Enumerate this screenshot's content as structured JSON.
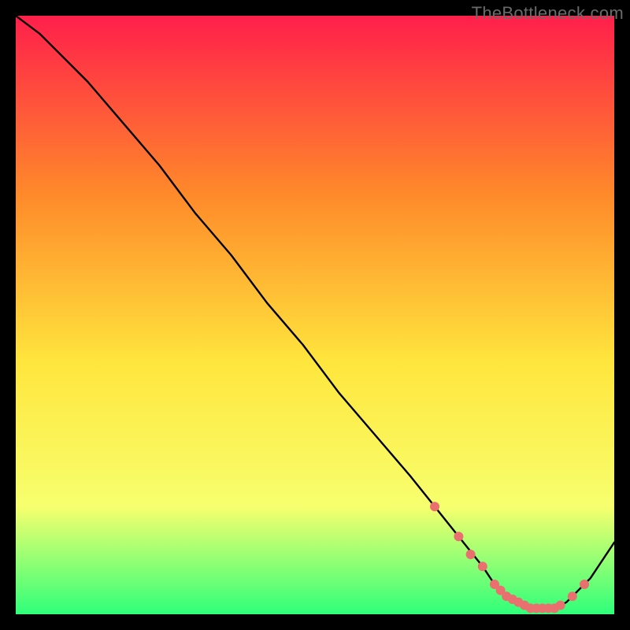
{
  "watermark": "TheBottleneck.com",
  "colors": {
    "background": "#000000",
    "gradient_top": "#ff1f4b",
    "gradient_mid1": "#ff8a2a",
    "gradient_mid2": "#ffe63d",
    "gradient_mid3": "#f7ff6e",
    "gradient_bottom": "#2fff7a",
    "curve": "#000000",
    "marker": "#e9706f"
  },
  "chart_data": {
    "type": "line",
    "title": "",
    "xlabel": "",
    "ylabel": "",
    "xlim": [
      0,
      100
    ],
    "ylim": [
      0,
      100
    ],
    "grid": false,
    "series": [
      {
        "name": "bottleneck-curve",
        "x": [
          0,
          4,
          8,
          12,
          18,
          24,
          30,
          36,
          42,
          48,
          54,
          60,
          66,
          70,
          74,
          78,
          80,
          82,
          84,
          86,
          88,
          90,
          92,
          96,
          100
        ],
        "y": [
          100,
          97,
          93,
          89,
          82,
          75,
          67,
          60,
          52,
          45,
          37,
          30,
          23,
          18,
          13,
          8,
          5,
          3,
          2,
          1,
          1,
          1,
          2,
          6,
          12
        ]
      }
    ],
    "markers": {
      "name": "optimal-range-points",
      "x": [
        70,
        74,
        76,
        78,
        80,
        81,
        82,
        83,
        84,
        85,
        86,
        87,
        88,
        89,
        90,
        91,
        93,
        95
      ],
      "y": [
        18,
        13,
        10,
        8,
        5,
        4,
        3,
        2.5,
        2,
        1.5,
        1,
        1,
        1,
        1,
        1,
        1.5,
        3,
        5
      ]
    }
  }
}
